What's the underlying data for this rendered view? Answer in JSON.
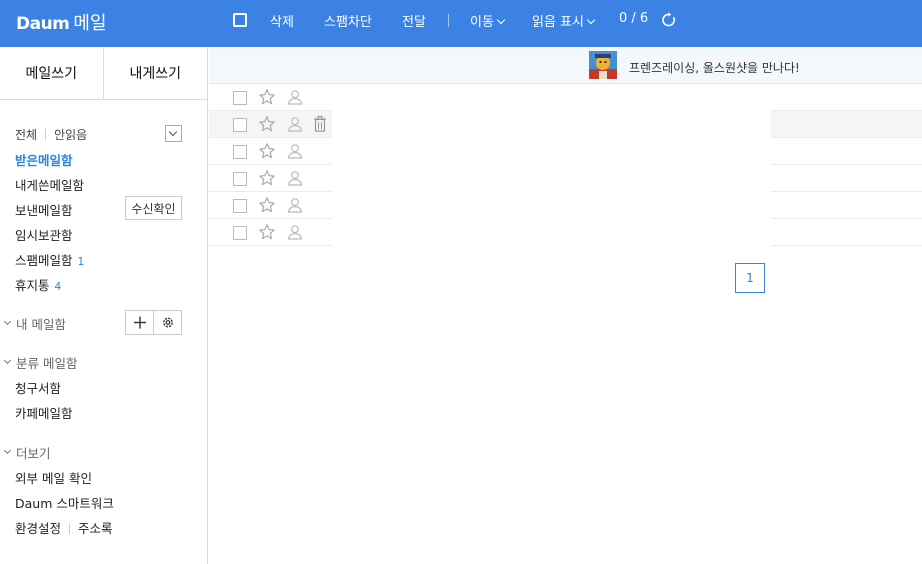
{
  "header": {
    "logo_brand": "Daum",
    "logo_service": "메일",
    "actions": {
      "delete": "삭제",
      "spam_block": "스팸차단",
      "forward": "전달",
      "move": "이동",
      "mark_read": "읽음 표시"
    },
    "count": "0 / 6",
    "accent_color": "#3b82e4"
  },
  "sidebar": {
    "compose": "메일쓰기",
    "self_compose": "내게쓰기",
    "filter_all": "전체",
    "filter_unread": "안읽음",
    "mailboxes": {
      "inbox": "받은메일함",
      "to_me": "내게쓴메일함",
      "sent": "보낸메일함",
      "drafts": "임시보관함",
      "spam": "스팸메일함",
      "spam_count": "1",
      "trash": "휴지통",
      "trash_count": "4"
    },
    "read_receipt": "수신확인",
    "my_mailboxes": "내 메일함",
    "category_mailboxes": "분류 메일함",
    "category": {
      "invoices": "청구서함",
      "cafe": "카페메일함"
    },
    "more": "더보기",
    "more_items": {
      "external": "외부 메일 확인",
      "smartwork": "Daum 스마트워크",
      "settings": "환경설정",
      "addressbook": "주소록"
    }
  },
  "main": {
    "promo_text": "프렌즈레이싱, 올스원샷을 만나다!",
    "page_number": "1",
    "row_count_visible": 6
  }
}
